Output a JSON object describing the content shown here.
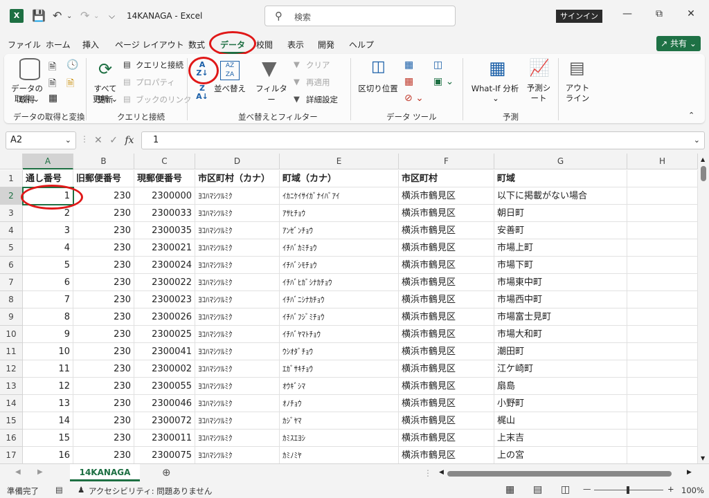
{
  "titlebar": {
    "app_icon": "X",
    "doc_title": "14KANAGA  -  Excel",
    "search_placeholder": "検索",
    "signin": "サインイン"
  },
  "tabs": [
    "ファイル",
    "ホーム",
    "挿入",
    "ページ レイアウト",
    "数式",
    "データ",
    "校閲",
    "表示",
    "開発",
    "ヘルプ"
  ],
  "active_tab": "データ",
  "share_label": "共有",
  "ribbon": {
    "get_data": "データの取得",
    "refresh_all": "すべて更新",
    "queries_connections": "クエリと接続",
    "properties": "プロパティ",
    "edit_links": "ブックのリンク",
    "sort_label": "並べ替え",
    "filter_label": "フィルター",
    "clear_label": "クリア",
    "reapply_label": "再適用",
    "advanced_label": "詳細設定",
    "text_to_columns": "区切り位置",
    "whatif": "What-If 分析",
    "forecast_sheet": "予測シート",
    "outline": "アウトライン",
    "group_get_transform": "データの取得と変換",
    "group_queries": "クエリと接続",
    "group_sort_filter": "並べ替えとフィルター",
    "group_data_tools": "データ ツール",
    "group_forecast": "予測"
  },
  "formula_bar": {
    "name_box": "A2",
    "fx": "fx",
    "value": "1"
  },
  "columns": [
    "A",
    "B",
    "C",
    "D",
    "E",
    "F",
    "G",
    "H"
  ],
  "rows": [
    [
      "通し番号",
      "旧郵便番号",
      "現郵便番号",
      "市区町村（カナ）",
      "町域（カナ）",
      "市区町村",
      "町域"
    ],
    [
      "1",
      "230",
      "2300000",
      "ﾖｺﾊﾏｼﾂﾙﾐｸ",
      "ｲｶﾆｹｲｻｲｶﾞﾅｲﾊﾞｱｲ",
      "横浜市鶴見区",
      "以下に掲載がない場合"
    ],
    [
      "2",
      "230",
      "2300033",
      "ﾖｺﾊﾏｼﾂﾙﾐｸ",
      "ｱｻﾋﾁｮｳ",
      "横浜市鶴見区",
      "朝日町"
    ],
    [
      "3",
      "230",
      "2300035",
      "ﾖｺﾊﾏｼﾂﾙﾐｸ",
      "ｱﾝｾﾞﾝﾁｮｳ",
      "横浜市鶴見区",
      "安善町"
    ],
    [
      "4",
      "230",
      "2300021",
      "ﾖｺﾊﾏｼﾂﾙﾐｸ",
      "ｲﾁﾊﾞｶﾐﾁｮｳ",
      "横浜市鶴見区",
      "市場上町"
    ],
    [
      "5",
      "230",
      "2300024",
      "ﾖｺﾊﾏｼﾂﾙﾐｸ",
      "ｲﾁﾊﾞｼﾓﾁｮｳ",
      "横浜市鶴見区",
      "市場下町"
    ],
    [
      "6",
      "230",
      "2300022",
      "ﾖｺﾊﾏｼﾂﾙﾐｸ",
      "ｲﾁﾊﾞﾋｶﾞｼﾅｶﾁｮｳ",
      "横浜市鶴見区",
      "市場東中町"
    ],
    [
      "7",
      "230",
      "2300023",
      "ﾖｺﾊﾏｼﾂﾙﾐｸ",
      "ｲﾁﾊﾞﾆｼﾅｶﾁｮｳ",
      "横浜市鶴見区",
      "市場西中町"
    ],
    [
      "8",
      "230",
      "2300026",
      "ﾖｺﾊﾏｼﾂﾙﾐｸ",
      "ｲﾁﾊﾞﾌｼﾞﾐﾁｮｳ",
      "横浜市鶴見区",
      "市場富士見町"
    ],
    [
      "9",
      "230",
      "2300025",
      "ﾖｺﾊﾏｼﾂﾙﾐｸ",
      "ｲﾁﾊﾞﾔﾏﾄﾁｮｳ",
      "横浜市鶴見区",
      "市場大和町"
    ],
    [
      "10",
      "230",
      "2300041",
      "ﾖｺﾊﾏｼﾂﾙﾐｸ",
      "ｳｼｵﾀﾞﾁｮｳ",
      "横浜市鶴見区",
      "潮田町"
    ],
    [
      "11",
      "230",
      "2300002",
      "ﾖｺﾊﾏｼﾂﾙﾐｸ",
      "ｴｶﾞｻｷﾁｮｳ",
      "横浜市鶴見区",
      "江ケ崎町"
    ],
    [
      "12",
      "230",
      "2300055",
      "ﾖｺﾊﾏｼﾂﾙﾐｸ",
      "ｵｳｷﾞｼﾏ",
      "横浜市鶴見区",
      "扇島"
    ],
    [
      "13",
      "230",
      "2300046",
      "ﾖｺﾊﾏｼﾂﾙﾐｸ",
      "ｵﾉﾁｮｳ",
      "横浜市鶴見区",
      "小野町"
    ],
    [
      "14",
      "230",
      "2300072",
      "ﾖｺﾊﾏｼﾂﾙﾐｸ",
      "ｶｼﾞﾔﾏ",
      "横浜市鶴見区",
      "梶山"
    ],
    [
      "15",
      "230",
      "2300011",
      "ﾖｺﾊﾏｼﾂﾙﾐｸ",
      "ｶﾐｽｴﾖｼ",
      "横浜市鶴見区",
      "上末吉"
    ],
    [
      "16",
      "230",
      "2300075",
      "ﾖｺﾊﾏｼﾂﾙﾐｸ",
      "ｶﾐﾉﾐﾔ",
      "横浜市鶴見区",
      "上の宮"
    ]
  ],
  "sheet_tab": "14KANAGA",
  "status": {
    "ready": "準備完了",
    "accessibility": "アクセシビリティ: 問題ありません",
    "zoom": "100%"
  },
  "colors": {
    "accent": "#1d6f42",
    "annotation": "#e01818"
  }
}
